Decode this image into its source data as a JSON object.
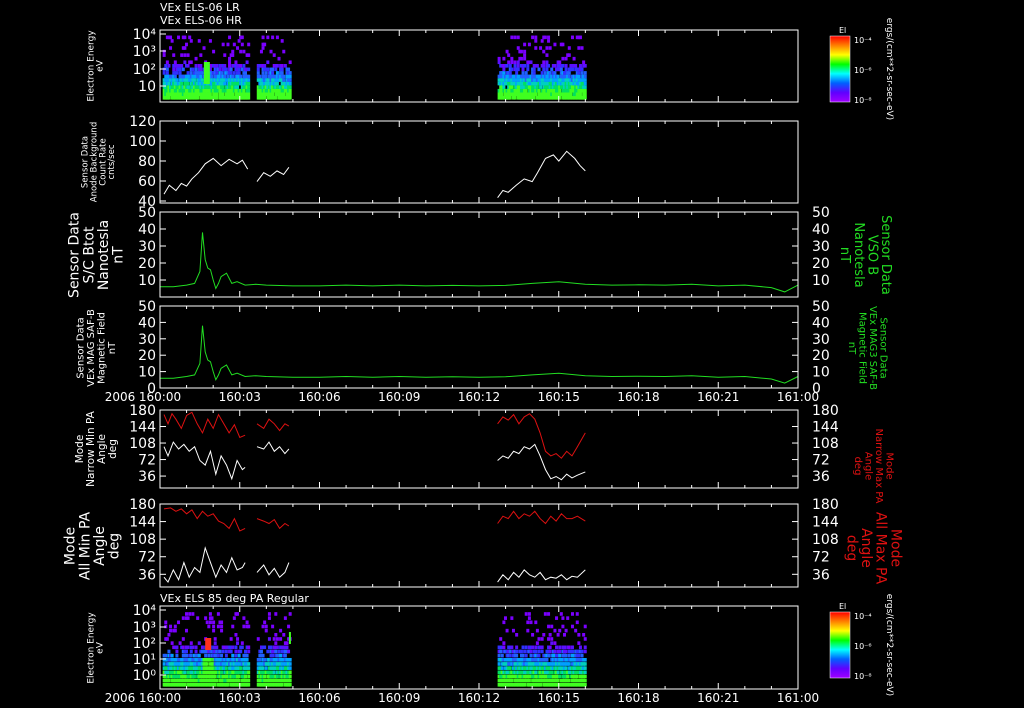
{
  "colors": {
    "bg": "#000000",
    "axis": "#ffffff",
    "white": "#ffffff",
    "green": "#22dd22",
    "red": "#dd1111",
    "blueish": "#3344ff"
  },
  "chart_data": [
    {
      "type": "heatmap",
      "top_labels": [
        "VEx ELS-06 LR",
        "VEx ELS-06 HR"
      ],
      "ylabel": [
        "Electron Energy",
        "eV"
      ],
      "y_scale": "log",
      "y_ticks": [
        "10⁴",
        "10³",
        "10²",
        "10"
      ],
      "ylim": [
        1,
        10000
      ],
      "colorbar": {
        "title": "El",
        "ticks": [
          "10⁻⁴",
          "10⁻⁶",
          "10⁻⁸"
        ]
      },
      "units": "ergs/(cm**2-sr-sec-eV)",
      "data_intervals": [
        [
          "160:00",
          "160:04.8"
        ],
        [
          "160:12.7",
          "160:16"
        ]
      ]
    },
    {
      "type": "line",
      "ylabel": [
        "Sensor Data",
        "Anode Background",
        "Count Rate",
        "cnts/sec"
      ],
      "y_ticks": [
        "120",
        "100",
        "80",
        "60",
        "40"
      ],
      "ylim": [
        28,
        120
      ],
      "series": [
        {
          "color": "#ffffff",
          "x": [
            0.15,
            0.35,
            0.6,
            0.8,
            1.0,
            1.2,
            1.45,
            1.7,
            2.0,
            2.3,
            2.6,
            2.9,
            3.1,
            3.3
          ],
          "y": [
            38,
            48,
            42,
            50,
            47,
            55,
            62,
            72,
            78,
            70,
            77,
            72,
            76,
            66
          ]
        },
        {
          "color": "#ffffff",
          "x": [
            3.65,
            3.9,
            4.15,
            4.4,
            4.65,
            4.85
          ],
          "y": [
            52,
            62,
            58,
            64,
            60,
            68
          ]
        },
        {
          "color": "#ffffff",
          "x": [
            12.7,
            12.9,
            13.1,
            13.4,
            13.7,
            14.0,
            14.2,
            14.5,
            14.8,
            15.0,
            15.3,
            15.6,
            15.8,
            16.0
          ],
          "y": [
            34,
            42,
            40,
            48,
            55,
            52,
            62,
            78,
            82,
            75,
            86,
            78,
            70,
            64
          ]
        }
      ]
    },
    {
      "type": "line",
      "ylabel": [
        "Sensor Data",
        "S/C Btot",
        "Nanotesla",
        "nT"
      ],
      "right_label": [
        "Sensor Data",
        "VSO B",
        "Nanotesla",
        "nT"
      ],
      "y_ticks": [
        "50",
        "40",
        "30",
        "20",
        "10"
      ],
      "ylim": [
        0,
        50
      ],
      "series": [
        {
          "color": "#22dd22",
          "x": [
            0,
            0.5,
            1.0,
            1.3,
            1.5,
            1.6,
            1.7,
            1.8,
            1.9,
            2.0,
            2.1,
            2.2,
            2.3,
            2.5,
            2.7,
            2.9,
            3.2,
            3.6,
            4.0,
            5,
            6,
            7,
            8,
            9,
            10,
            11,
            12,
            13,
            14,
            15,
            16,
            17,
            18,
            19,
            20,
            21,
            22,
            23,
            23.5,
            24
          ],
          "y": [
            6,
            6,
            7,
            8,
            15,
            38,
            22,
            17,
            16,
            10,
            5,
            8,
            12,
            14,
            8,
            9,
            7,
            7.5,
            7,
            6.5,
            6.5,
            7,
            6.5,
            7,
            6.5,
            6.8,
            6.5,
            6.8,
            8,
            9,
            7.5,
            7,
            7.2,
            7,
            7.5,
            6.5,
            7,
            5.5,
            3,
            7
          ]
        }
      ]
    },
    {
      "type": "line",
      "ylabel": [
        "Sensor Data",
        "VEx MAG SAF-B",
        "Magnetic Field",
        "nT"
      ],
      "right_label": [
        "Sensor Data",
        "VEx MAG3 SAF-B",
        "Magnetic Field",
        "nT"
      ],
      "y_ticks": [
        "50",
        "40",
        "30",
        "20",
        "10",
        "0"
      ],
      "ylim": [
        0,
        50
      ],
      "series": [
        {
          "color": "#22dd22",
          "x": [
            0,
            0.5,
            1.0,
            1.3,
            1.5,
            1.6,
            1.7,
            1.8,
            1.9,
            2.0,
            2.1,
            2.2,
            2.3,
            2.5,
            2.7,
            2.9,
            3.2,
            3.6,
            4.0,
            5,
            6,
            7,
            8,
            9,
            10,
            11,
            12,
            13,
            14,
            15,
            16,
            17,
            18,
            19,
            20,
            21,
            22,
            23,
            23.5,
            24
          ],
          "y": [
            6,
            6,
            7,
            8,
            15,
            38,
            22,
            17,
            16,
            10,
            5,
            8,
            12,
            14,
            8,
            9,
            7,
            7.5,
            7,
            6.5,
            6.5,
            7,
            6.5,
            7,
            6.5,
            6.8,
            6.5,
            6.8,
            8,
            9,
            7.5,
            7,
            7.2,
            7,
            7.5,
            6.5,
            7,
            5.5,
            3,
            7
          ]
        }
      ]
    },
    {
      "type": "line",
      "ylabel": [
        "Mode",
        "Narrow Min PA",
        "Angle",
        "deg"
      ],
      "right_label": [
        "Mode",
        "Narrow Max PA",
        "Angle",
        "deg"
      ],
      "y_ticks": [
        "180",
        "144",
        "108",
        "72",
        "36"
      ],
      "ylim": [
        10,
        180
      ],
      "series": [
        {
          "color": "#dd1111",
          "x": [
            0.15,
            0.3,
            0.45,
            0.6,
            0.8,
            1.0,
            1.2,
            1.4,
            1.6,
            1.8,
            2.0,
            2.2,
            2.4,
            2.6,
            2.8,
            3.0,
            3.2
          ],
          "y": [
            170,
            150,
            172,
            160,
            140,
            168,
            175,
            150,
            130,
            160,
            140,
            170,
            150,
            130,
            148,
            120,
            125
          ]
        },
        {
          "color": "#ffffff",
          "x": [
            0.15,
            0.3,
            0.5,
            0.7,
            0.9,
            1.1,
            1.3,
            1.5,
            1.7,
            1.9,
            2.1,
            2.3,
            2.5,
            2.7,
            2.9,
            3.1,
            3.2
          ],
          "y": [
            100,
            80,
            110,
            95,
            105,
            90,
            100,
            70,
            60,
            90,
            40,
            80,
            60,
            30,
            70,
            50,
            55
          ]
        },
        {
          "color": "#dd1111",
          "x": [
            3.65,
            3.9,
            4.1,
            4.3,
            4.5,
            4.7,
            4.85
          ],
          "y": [
            150,
            140,
            160,
            150,
            135,
            150,
            145
          ]
        },
        {
          "color": "#ffffff",
          "x": [
            3.65,
            3.9,
            4.1,
            4.3,
            4.5,
            4.7,
            4.85
          ],
          "y": [
            100,
            95,
            110,
            90,
            100,
            85,
            95
          ]
        },
        {
          "color": "#dd1111",
          "x": [
            12.7,
            12.9,
            13.1,
            13.3,
            13.5,
            13.7,
            13.9,
            14.1,
            14.3,
            14.5,
            14.7,
            14.9,
            15.1,
            15.3,
            15.5,
            15.7,
            16.0
          ],
          "y": [
            150,
            165,
            158,
            170,
            150,
            165,
            172,
            160,
            130,
            90,
            80,
            85,
            75,
            90,
            80,
            100,
            130
          ]
        },
        {
          "color": "#ffffff",
          "x": [
            12.7,
            12.9,
            13.1,
            13.3,
            13.5,
            13.7,
            13.9,
            14.1,
            14.3,
            14.5,
            14.7,
            14.9,
            15.1,
            15.3,
            15.5,
            15.7,
            16.0
          ],
          "y": [
            70,
            80,
            75,
            90,
            85,
            100,
            95,
            105,
            80,
            50,
            30,
            35,
            28,
            40,
            32,
            38,
            45
          ]
        }
      ]
    },
    {
      "type": "line",
      "ylabel": [
        "Mode",
        "All Min PA",
        "Angle",
        "deg"
      ],
      "right_label": [
        "Mode",
        "All Max PA",
        "Angle",
        "deg"
      ],
      "y_ticks": [
        "180",
        "144",
        "108",
        "72",
        "36"
      ],
      "ylim": [
        10,
        180
      ],
      "series": [
        {
          "color": "#dd1111",
          "x": [
            0.15,
            0.4,
            0.6,
            0.8,
            1.0,
            1.2,
            1.4,
            1.6,
            1.8,
            2.0,
            2.2,
            2.4,
            2.6,
            2.8,
            3.0,
            3.2
          ],
          "y": [
            170,
            172,
            165,
            170,
            160,
            168,
            150,
            165,
            155,
            160,
            145,
            140,
            130,
            150,
            125,
            130
          ]
        },
        {
          "color": "#ffffff",
          "x": [
            0.15,
            0.3,
            0.5,
            0.7,
            0.9,
            1.1,
            1.3,
            1.5,
            1.7,
            1.9,
            2.1,
            2.3,
            2.5,
            2.7,
            2.9,
            3.1,
            3.2
          ],
          "y": [
            30,
            20,
            45,
            25,
            60,
            30,
            50,
            40,
            90,
            60,
            30,
            55,
            40,
            70,
            45,
            50,
            60
          ]
        },
        {
          "color": "#dd1111",
          "x": [
            3.65,
            3.9,
            4.1,
            4.3,
            4.5,
            4.7,
            4.85
          ],
          "y": [
            150,
            145,
            140,
            148,
            130,
            140,
            135
          ]
        },
        {
          "color": "#ffffff",
          "x": [
            3.65,
            3.9,
            4.1,
            4.3,
            4.5,
            4.7,
            4.85
          ],
          "y": [
            40,
            55,
            35,
            48,
            30,
            40,
            60
          ]
        },
        {
          "color": "#dd1111",
          "x": [
            12.7,
            12.9,
            13.1,
            13.3,
            13.5,
            13.7,
            13.9,
            14.1,
            14.3,
            14.5,
            14.7,
            14.9,
            15.1,
            15.3,
            15.5,
            15.7,
            16.0
          ],
          "y": [
            140,
            155,
            150,
            165,
            150,
            160,
            155,
            165,
            150,
            140,
            155,
            145,
            160,
            150,
            150,
            155,
            145
          ]
        },
        {
          "color": "#ffffff",
          "x": [
            12.7,
            12.9,
            13.1,
            13.3,
            13.5,
            13.7,
            13.9,
            14.1,
            14.3,
            14.5,
            14.7,
            14.9,
            15.1,
            15.3,
            15.5,
            15.7,
            16.0
          ],
          "y": [
            20,
            35,
            25,
            40,
            30,
            45,
            35,
            30,
            40,
            25,
            30,
            28,
            35,
            25,
            32,
            30,
            45
          ]
        }
      ]
    },
    {
      "type": "heatmap",
      "top_labels": [
        "VEx ELS 85 deg PA Regular"
      ],
      "ylabel": [
        "Electron Energy",
        "eV"
      ],
      "y_scale": "log",
      "y_ticks": [
        "10⁴",
        "10³",
        "10²",
        "10¹",
        "10⁰"
      ],
      "ylim": [
        1,
        10000
      ],
      "colorbar": {
        "title": "El",
        "ticks": [
          "10⁻⁴",
          "10⁻⁶",
          "10⁻⁸"
        ]
      },
      "units": "ergs/(cm**2-sr-sec-eV)",
      "data_intervals": [
        [
          "160:00",
          "160:04.8"
        ],
        [
          "160:12.7",
          "160:16"
        ]
      ]
    }
  ],
  "x_axis": {
    "ticks": [
      "160:00",
      "160:03",
      "160:06",
      "160:09",
      "160:12",
      "160:15",
      "160:18",
      "160:21",
      "161:00"
    ],
    "year": "2006",
    "range_minutes": [
      0,
      24
    ]
  }
}
